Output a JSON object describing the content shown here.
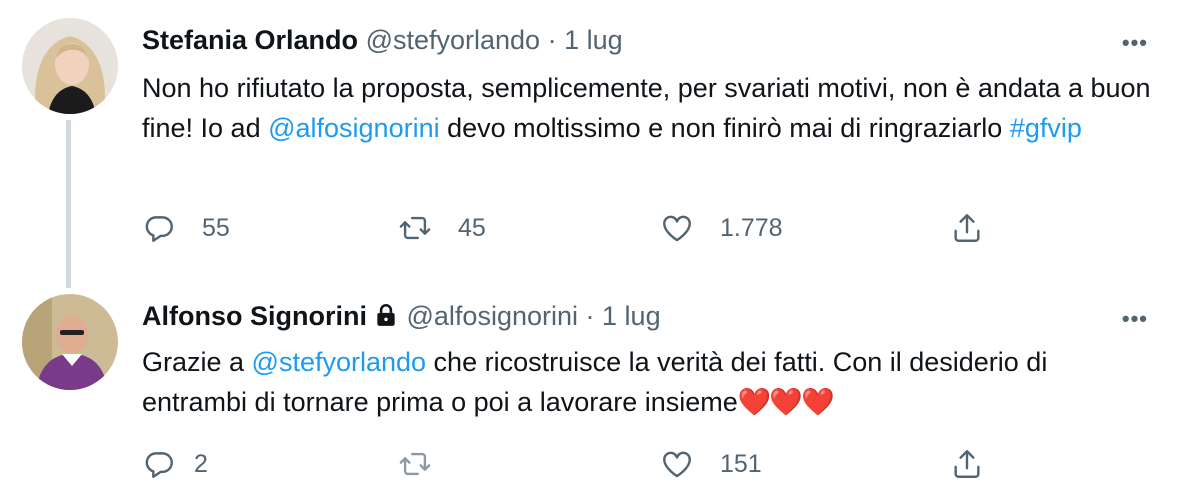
{
  "tweets": [
    {
      "name": "Stefania Orlando",
      "handle": "@stefyorlando",
      "separator": "·",
      "date": "1 lug",
      "text_parts": {
        "p1": "Non ho rifiutato la proposta, semplicemente, per svariati motivi, non è andata a buon fine! Io ad ",
        "mention": "@alfosignorini",
        "p2": " devo moltissimo e non finirò mai di ringraziarlo ",
        "hashtag": "#gfvip"
      },
      "replies": "55",
      "retweets": "45",
      "likes": "1.778",
      "more": "•••"
    },
    {
      "name": "Alfonso Signorini",
      "handle": "@alfosignorini",
      "separator": "·",
      "date": "1 lug",
      "protected_icon": "lock-icon",
      "text_parts": {
        "p1": "Grazie a ",
        "mention": "@stefyorlando",
        "p2": " che ricostruisce la verità dei fatti. Con il desiderio di entrambi di tornare prima o poi a lavorare insieme",
        "emoji": "❤️❤️❤️"
      },
      "replies": "2",
      "retweets": "",
      "likes": "151",
      "more": "•••"
    }
  ],
  "colors": {
    "text": "#0f1419",
    "secondary": "#536471",
    "link": "#1d9bf0",
    "thread_line": "#cfd9de",
    "heart_emoji": "#e0245e"
  },
  "icons": [
    "reply-icon",
    "retweet-icon",
    "like-icon",
    "share-icon",
    "more-icon",
    "lock-icon"
  ]
}
